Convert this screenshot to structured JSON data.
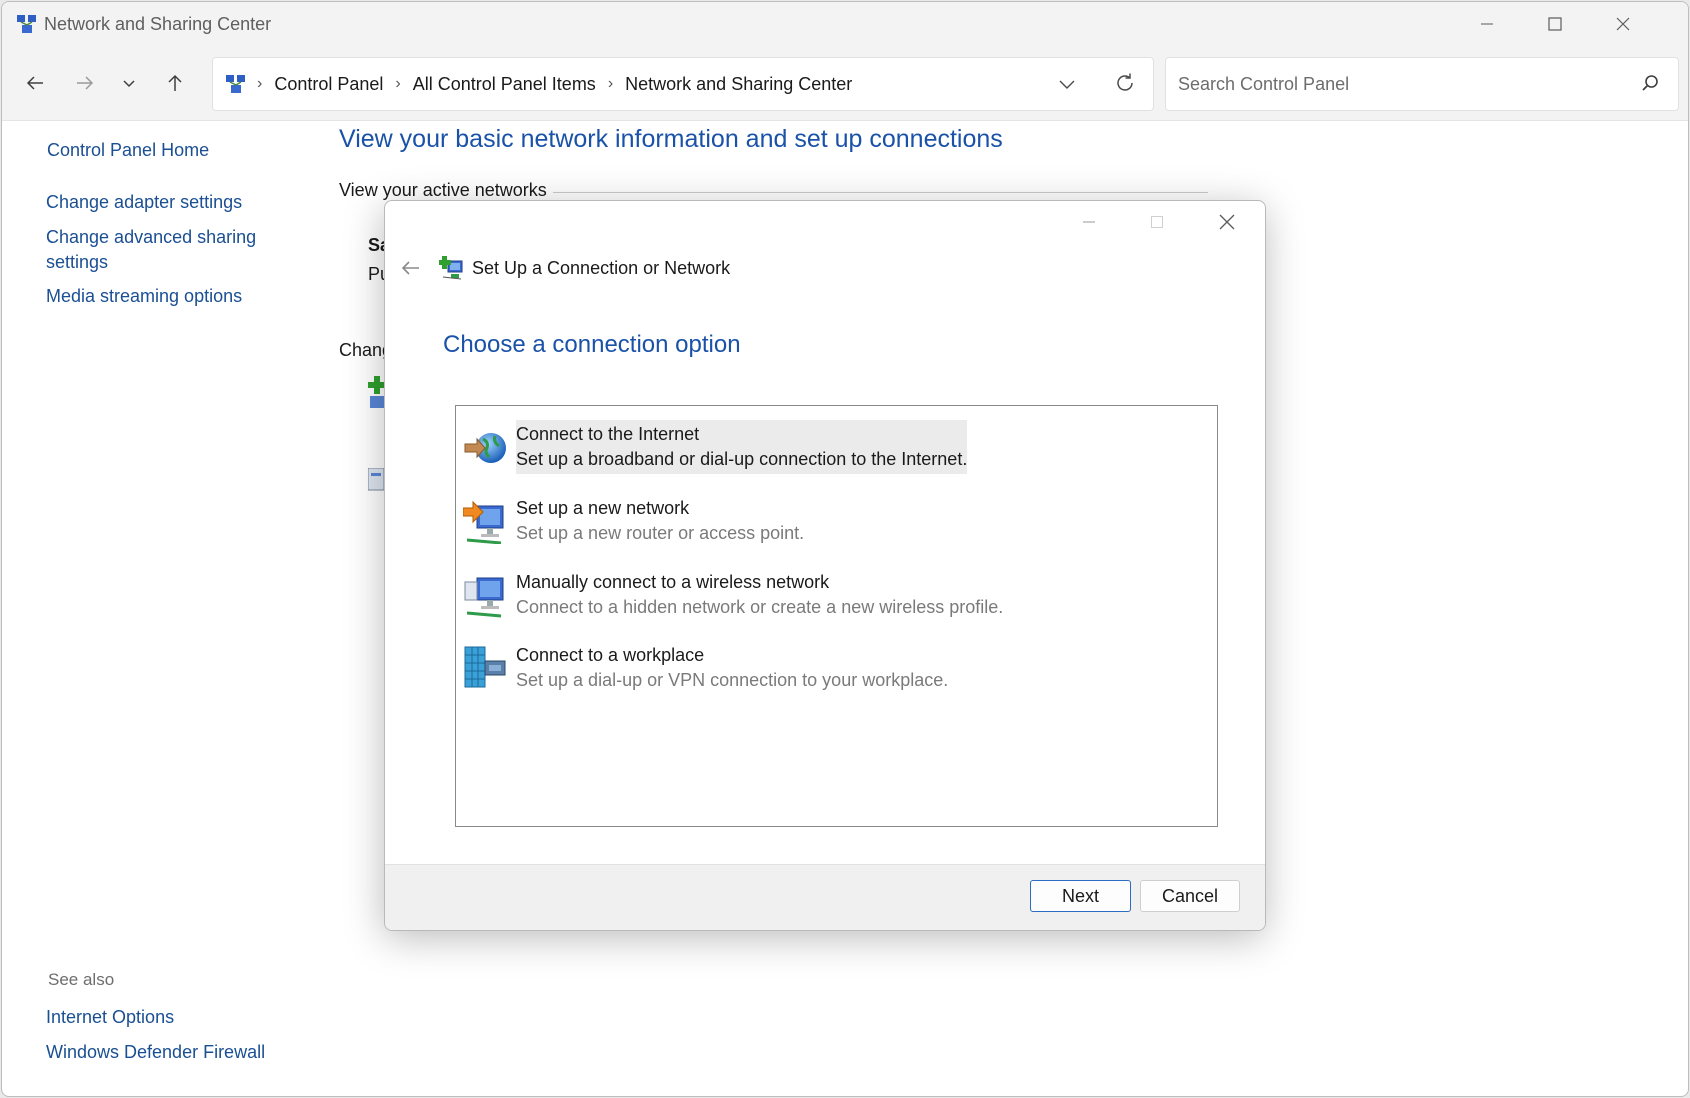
{
  "window": {
    "title": "Network and Sharing Center"
  },
  "address_bar": {
    "crumbs": [
      "Control Panel",
      "All Control Panel Items",
      "Network and Sharing Center"
    ]
  },
  "search": {
    "placeholder": "Search Control Panel"
  },
  "sidebar": {
    "home": "Control Panel Home",
    "links": [
      "Change adapter settings",
      "Change advanced sharing settings",
      "Media streaming options"
    ],
    "see_also_label": "See also",
    "see_also": [
      "Internet Options",
      "Windows Defender Firewall"
    ]
  },
  "main": {
    "title": "View your basic network information and set up connections",
    "active_networks_label": "View your active networks",
    "fragment_1": "Sa",
    "fragment_2": "Pu",
    "fragment_3": "Chang"
  },
  "dialog": {
    "title": "Set Up a Connection or Network",
    "heading": "Choose a connection option",
    "options": [
      {
        "title": "Connect to the Internet",
        "desc": "Set up a broadband or dial-up connection to the Internet.",
        "icon": "globe-icon",
        "selected": true
      },
      {
        "title": "Set up a new network",
        "desc": "Set up a new router or access point.",
        "icon": "new-network-icon",
        "selected": false
      },
      {
        "title": "Manually connect to a wireless network",
        "desc": "Connect to a hidden network or create a new wireless profile.",
        "icon": "wireless-network-icon",
        "selected": false
      },
      {
        "title": "Connect to a workplace",
        "desc": "Set up a dial-up or VPN connection to your workplace.",
        "icon": "workplace-icon",
        "selected": false
      }
    ],
    "next_label": "Next",
    "cancel_label": "Cancel"
  },
  "colors": {
    "link": "#1a4f93",
    "heading": "#1a52a8",
    "primary_button_border": "#2b6cc4"
  }
}
